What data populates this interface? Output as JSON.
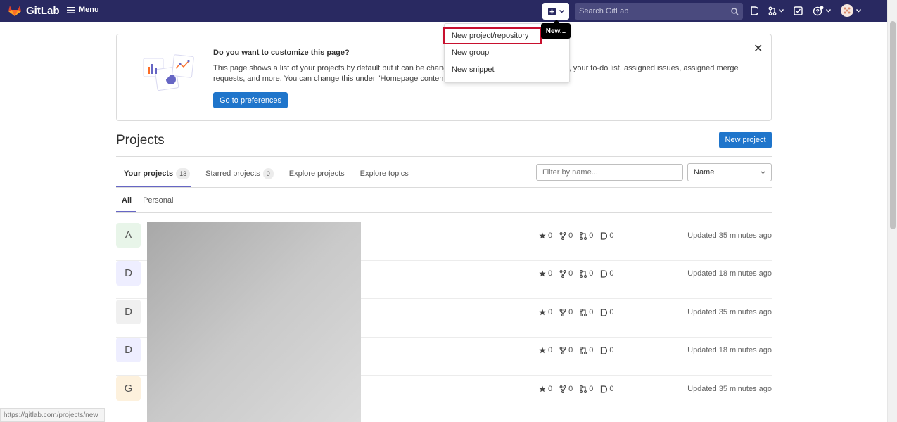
{
  "topbar": {
    "brand": "GitLab",
    "menu_label": "Menu",
    "search_placeholder": "Search GitLab"
  },
  "tooltip": "New...",
  "new_dropdown": {
    "items": [
      {
        "label": "New project/repository",
        "highlighted": true
      },
      {
        "label": "New group"
      },
      {
        "label": "New snippet"
      }
    ]
  },
  "banner": {
    "title": "Do you want to customize this page?",
    "body": "This page shows a list of your projects by default but it can be changed to show projects' activity, groups, your to-do list, assigned issues, assigned merge requests, and more. You can change this under \"Homepage content\" in your preferences",
    "button": "Go to preferences"
  },
  "page": {
    "title": "Projects",
    "new_project": "New project"
  },
  "tabs": [
    {
      "label": "Your projects",
      "count": "13",
      "active": true
    },
    {
      "label": "Starred projects",
      "count": "0"
    },
    {
      "label": "Explore projects"
    },
    {
      "label": "Explore topics"
    }
  ],
  "filter_placeholder": "Filter by name...",
  "sort_label": "Name",
  "subtabs": [
    {
      "label": "All",
      "active": true
    },
    {
      "label": "Personal"
    }
  ],
  "projects": [
    {
      "letter": "A",
      "color": "#e8f5e9",
      "stars": "0",
      "forks": "0",
      "mrs": "0",
      "issues": "0",
      "updated": "Updated 35 minutes ago"
    },
    {
      "letter": "D",
      "color": "#eeeeff",
      "stars": "0",
      "forks": "0",
      "mrs": "0",
      "issues": "0",
      "updated": "Updated 18 minutes ago"
    },
    {
      "letter": "D",
      "color": "#f0f0f0",
      "stars": "0",
      "forks": "0",
      "mrs": "0",
      "issues": "0",
      "updated": "Updated 35 minutes ago"
    },
    {
      "letter": "D",
      "color": "#eeeeff",
      "stars": "0",
      "forks": "0",
      "mrs": "0",
      "issues": "0",
      "updated": "Updated 18 minutes ago"
    },
    {
      "letter": "G",
      "color": "#fdf1dd",
      "stars": "0",
      "forks": "0",
      "mrs": "0",
      "issues": "0",
      "updated": "Updated 35 minutes ago"
    }
  ],
  "statusbar": "https://gitlab.com/projects/new"
}
